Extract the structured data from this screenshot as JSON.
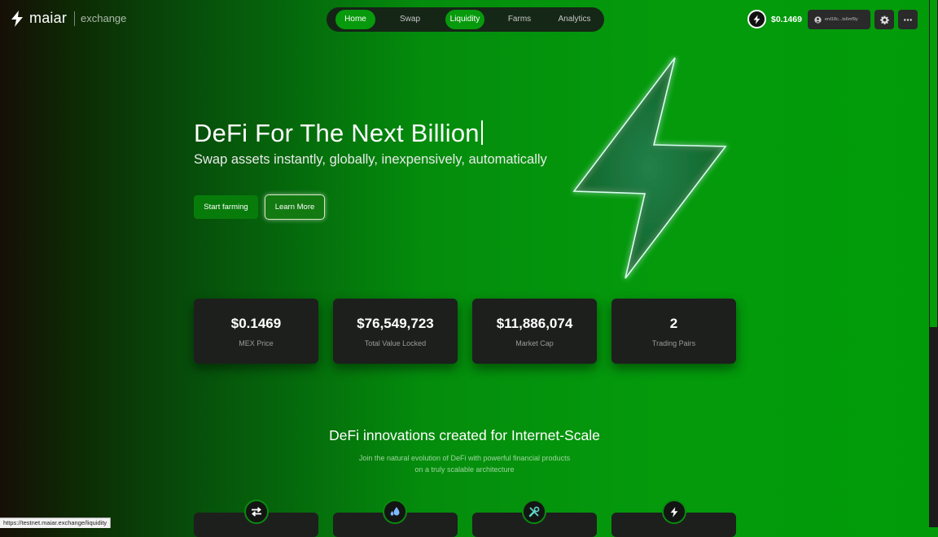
{
  "header": {
    "logo_text": "maiar",
    "logo_sub": "exchange",
    "nav": [
      "Home",
      "Swap",
      "Liquidity",
      "Farms",
      "Analytics"
    ],
    "nav_active": [
      "Home",
      "Liquidity"
    ],
    "mex_price": "$0.1469",
    "wallet_address": "erd18c...ts6mf9y",
    "icons": [
      "user-icon",
      "gear-icon",
      "more-icon"
    ]
  },
  "hero": {
    "title": "DeFi For The Next Billion",
    "subtitle": "Swap assets instantly, globally, inexpensively, automatically",
    "primary_button": "Start farming",
    "secondary_button": "Learn More"
  },
  "stats": [
    {
      "value": "$0.1469",
      "label": "MEX Price"
    },
    {
      "value": "$76,549,723",
      "label": "Total Value Locked"
    },
    {
      "value": "$11,886,074",
      "label": "Market Cap"
    },
    {
      "value": "2",
      "label": "Trading Pairs"
    }
  ],
  "features": {
    "title": "DeFi innovations created for Internet-Scale",
    "description_line1": "Join the natural evolution of DeFi with powerful financial products",
    "description_line2": "on a truly scalable architecture",
    "icons": [
      "swap-icon",
      "liquidity-drop-icon",
      "tools-icon",
      "bolt-icon"
    ]
  },
  "status_bar": {
    "url": "https://testnet.maiar.exchange/liquidity"
  },
  "colors": {
    "accent_green": "#079a0c",
    "card_bg": "#1d1f1d",
    "dark_bg": "#160f06"
  }
}
